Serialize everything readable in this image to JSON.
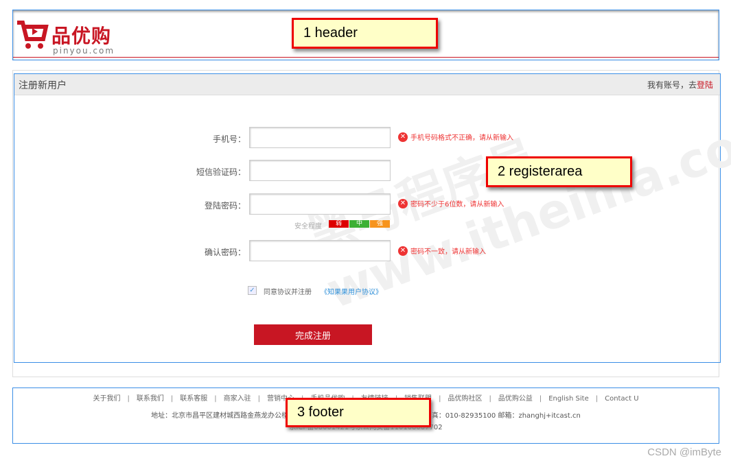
{
  "header": {
    "logo_text": "品优购",
    "logo_sub": "pinyou.com",
    "callout": "1  header"
  },
  "register": {
    "title": "注册新用户",
    "login_prompt": "我有账号，去",
    "login_link": "登陆",
    "callout": "2  registerarea",
    "watermark": "黑马程序员 www.itheima.com",
    "fields": [
      {
        "label": "手机号：",
        "value": "",
        "error": "手机号码格式不正确，请从新输入"
      },
      {
        "label": "短信验证码：",
        "value": "",
        "error": ""
      },
      {
        "label": "登陆密码：",
        "value": "",
        "error": "密码不少于6位数，请从新输入"
      },
      {
        "label": "确认密码：",
        "value": "",
        "error": "密码不一致，请从新输入"
      }
    ],
    "strength": {
      "label": "安全程度",
      "levels": [
        "弱",
        "中",
        "强"
      ],
      "colors": [
        "#dd0000",
        "#3cb034",
        "#f7941d"
      ]
    },
    "agree": {
      "checked": true,
      "label": "同意协议并注册",
      "link": "《知果果用户协议》"
    },
    "submit": "完成注册"
  },
  "footer": {
    "callout": "3 footer",
    "links": [
      "关于我们",
      "联系我们",
      "联系客服",
      "商家入驻",
      "营销中心",
      "手机品优购",
      "友情链接",
      "销售联盟",
      "品优购社区",
      "品优购公益",
      "English Site",
      "Contact U"
    ],
    "address": "地址：北京市昌平区建材城西路金燕龙办公楼一层 邮编：100096 电话：400-618-4000 传真：010-82935100 邮箱：zhanghj+itcast.cn",
    "icp": "京ICP备08001421号京公网安备110108007702"
  },
  "watermark_corner": "CSDN @imByte",
  "colors": {
    "brand": "#c81623",
    "annotation_border": "#3a8ee6",
    "callout_bg": "#ffffc8"
  }
}
